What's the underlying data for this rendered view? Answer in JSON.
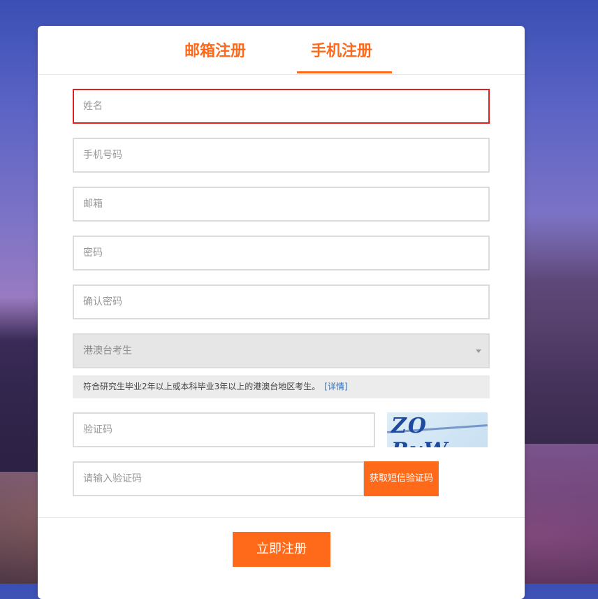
{
  "colors": {
    "accent": "#ff6a1a",
    "error_border": "#e02020",
    "link": "#2a73c2"
  },
  "tabs": [
    {
      "label": "邮箱注册",
      "active": false
    },
    {
      "label": "手机注册",
      "active": true
    }
  ],
  "form": {
    "name_placeholder": "姓名",
    "phone_placeholder": "手机号码",
    "email_placeholder": "邮箱",
    "password_placeholder": "密码",
    "confirm_password_placeholder": "确认密码",
    "candidate_type_selected": "港澳台考生",
    "candidate_hint": "符合研究生毕业2年以上或本科毕业3年以上的港澳台地区考生。",
    "details_link": "[详情]",
    "captcha_placeholder": "验证码",
    "captcha_text": "ZO RvW",
    "sms_code_placeholder": "请输入验证码",
    "sms_button_label": "获取短信验证码",
    "submit_label": "立即注册"
  },
  "icons": {
    "select_arrow": "chevron-down-icon"
  }
}
